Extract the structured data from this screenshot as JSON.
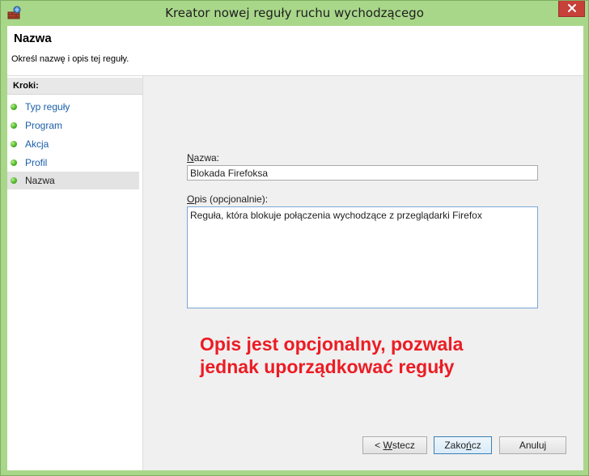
{
  "window": {
    "title": "Kreator nowej reguły ruchu wychodzącego"
  },
  "header": {
    "title": "Nazwa",
    "subtitle": "Określ nazwę i opis tej reguły."
  },
  "steps": {
    "title": "Kroki:",
    "items": [
      {
        "label": "Typ reguły"
      },
      {
        "label": "Program"
      },
      {
        "label": "Akcja"
      },
      {
        "label": "Profil"
      },
      {
        "label": "Nazwa"
      }
    ]
  },
  "form": {
    "name_label_mnemonic": "N",
    "name_label_rest": "azwa:",
    "name_value": "Blokada Firefoksa",
    "desc_label_mnemonic": "O",
    "desc_label_rest": "pis (opcjonalnie):",
    "desc_value": "Reguła, która blokuje połączenia wychodzące z przeglądarki Firefox"
  },
  "annotation": {
    "line1": "Opis jest opcjonalny, pozwala",
    "line2": "jednak uporządkować reguły"
  },
  "buttons": {
    "back_prefix": "< ",
    "back_mnemonic": "W",
    "back_rest": "stecz",
    "finish_prefix": "Zako",
    "finish_mnemonic": "ń",
    "finish_rest": "cz",
    "cancel": "Anuluj"
  },
  "colors": {
    "frame": "#a9d78a",
    "close_button": "#c7403a",
    "step_link": "#1a5fa8",
    "annotation": "#ec1c24"
  }
}
